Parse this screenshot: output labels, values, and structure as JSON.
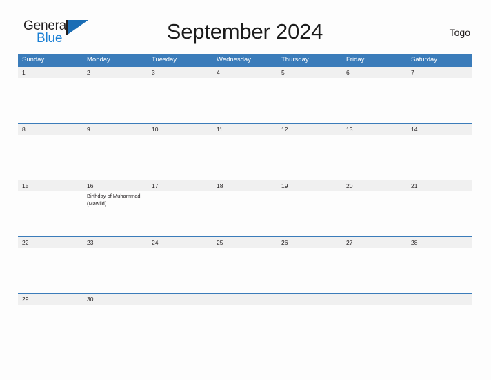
{
  "brand": {
    "name_top": "General",
    "name_bottom": "Blue",
    "mark": "flag-triangle-icon",
    "accent_color": "#1a6db5",
    "text_color": "#231f20"
  },
  "header": {
    "title": "September 2024",
    "country": "Togo"
  },
  "calendar": {
    "header_color": "#3b7cba",
    "date_band_color": "#f0f0f0",
    "weekdays": [
      "Sunday",
      "Monday",
      "Tuesday",
      "Wednesday",
      "Thursday",
      "Friday",
      "Saturday"
    ],
    "weeks": [
      {
        "dates": [
          "1",
          "2",
          "3",
          "4",
          "5",
          "6",
          "7"
        ],
        "events": [
          "",
          "",
          "",
          "",
          "",
          "",
          ""
        ]
      },
      {
        "dates": [
          "8",
          "9",
          "10",
          "11",
          "12",
          "13",
          "14"
        ],
        "events": [
          "",
          "",
          "",
          "",
          "",
          "",
          ""
        ]
      },
      {
        "dates": [
          "15",
          "16",
          "17",
          "18",
          "19",
          "20",
          "21"
        ],
        "events": [
          "",
          "Birthday of Muhammad (Mawlid)",
          "",
          "",
          "",
          "",
          ""
        ]
      },
      {
        "dates": [
          "22",
          "23",
          "24",
          "25",
          "26",
          "27",
          "28"
        ],
        "events": [
          "",
          "",
          "",
          "",
          "",
          "",
          ""
        ]
      },
      {
        "dates": [
          "29",
          "30",
          "",
          "",
          "",
          "",
          ""
        ],
        "events": [
          "",
          "",
          "",
          "",
          "",
          "",
          ""
        ]
      }
    ]
  }
}
